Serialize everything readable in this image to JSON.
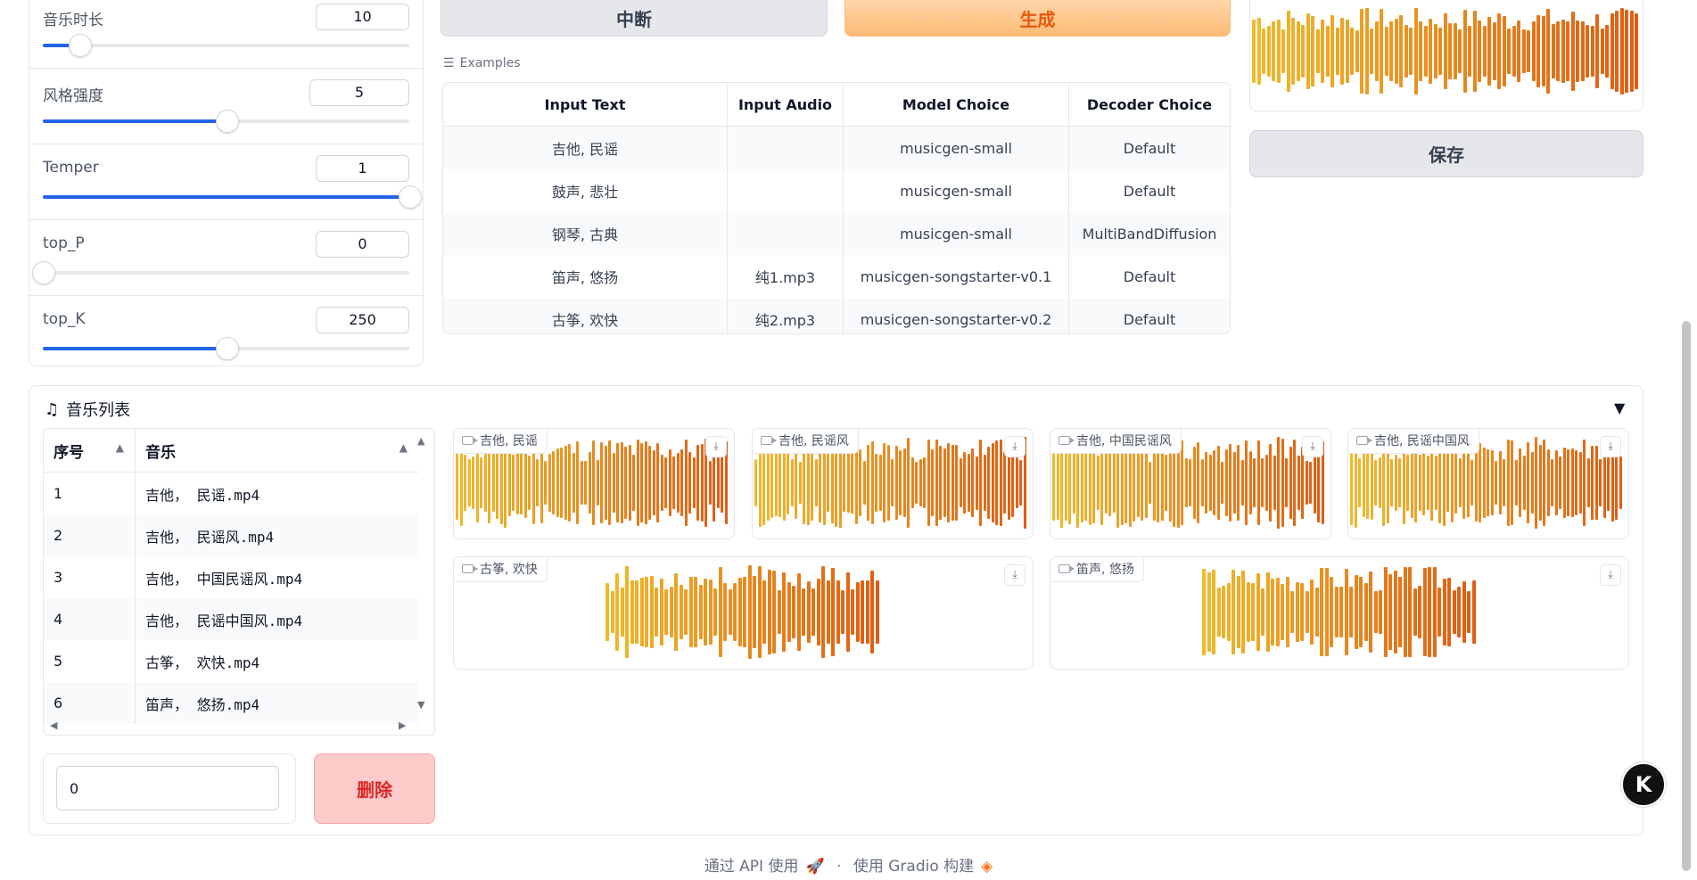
{
  "params": [
    {
      "label": "音乐时长",
      "value": "10",
      "fill": 0.1
    },
    {
      "label": "风格强度",
      "value": "5",
      "fill": 0.5
    },
    {
      "label": "Temper",
      "value": "1",
      "fill": 1.0
    },
    {
      "label": "top_P",
      "value": "0",
      "fill": 0.0
    },
    {
      "label": "top_K",
      "value": "250",
      "fill": 0.5
    }
  ],
  "buttons": {
    "stop": "中断",
    "generate": "生成",
    "save": "保存",
    "delete": "删除"
  },
  "examples": {
    "label": "Examples",
    "headers": [
      "Input Text",
      "Input Audio",
      "Model Choice",
      "Decoder Choice"
    ],
    "rows": [
      [
        "吉他, 民谣",
        "",
        "musicgen-small",
        "Default"
      ],
      [
        "鼓声, 悲壮",
        "",
        "musicgen-small",
        "Default"
      ],
      [
        "钢琴, 古典",
        "",
        "musicgen-small",
        "MultiBandDiffusion"
      ],
      [
        "笛声, 悠扬",
        "纯1.mp3",
        "musicgen-songstarter-v0.1",
        "Default"
      ],
      [
        "古筝, 欢快",
        "纯2.mp3",
        "musicgen-songstarter-v0.2",
        "Default"
      ]
    ]
  },
  "music_list": {
    "title": "音乐列表",
    "headers": [
      "序号",
      "音乐"
    ],
    "rows": [
      [
        "1",
        "吉他， 民谣.mp4"
      ],
      [
        "2",
        "吉他， 民谣风.mp4"
      ],
      [
        "3",
        "吉他， 中国民谣风.mp4"
      ],
      [
        "4",
        "吉他， 民谣中国风.mp4"
      ],
      [
        "5",
        "古筝， 欢快.mp4"
      ],
      [
        "6",
        "笛声， 悠扬.mp4"
      ]
    ],
    "index_value": "0"
  },
  "videos": [
    {
      "label": "吉他, 民谣"
    },
    {
      "label": "吉他, 民谣风"
    },
    {
      "label": "吉他, 中国民谣风"
    },
    {
      "label": "吉他, 民谣中国风"
    },
    {
      "label": "古筝, 欢快"
    },
    {
      "label": "笛声, 悠扬"
    }
  ],
  "footer": {
    "api": "通过 API 使用",
    "sep": "·",
    "built": "使用 Gradio 构建"
  },
  "colors": {
    "wave_start": "#f0b92a",
    "wave_end": "#e05d12",
    "accent": "#2563eb"
  }
}
